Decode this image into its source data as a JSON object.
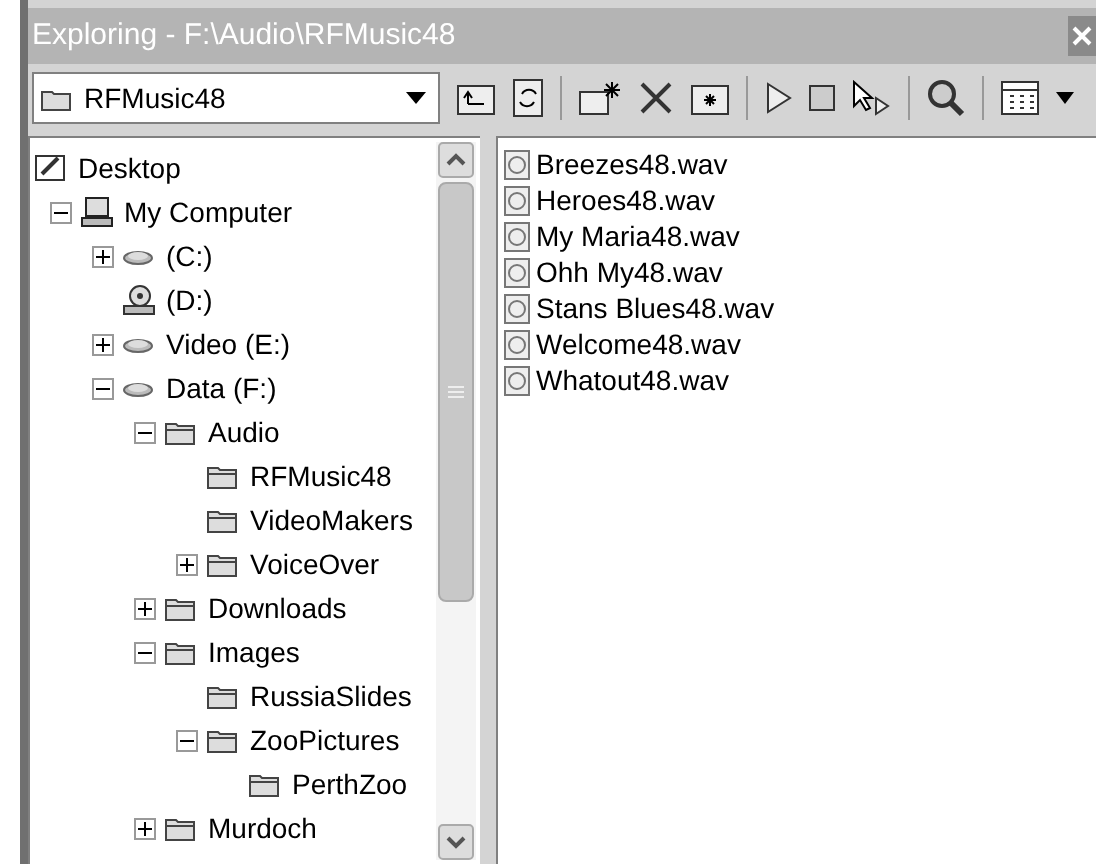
{
  "window": {
    "title": "Exploring - F:\\Audio\\RFMusic48"
  },
  "address": {
    "value": "RFMusic48"
  },
  "tree": [
    {
      "label": "Desktop",
      "kind": "desktop",
      "children": [
        {
          "label": "My Computer",
          "kind": "computer",
          "expanded": true,
          "children": [
            {
              "label": "(C:)",
              "kind": "drive",
              "expanded": false
            },
            {
              "label": "(D:)",
              "kind": "cdrom"
            },
            {
              "label": "Video (E:)",
              "kind": "drive",
              "expanded": false
            },
            {
              "label": "Data (F:)",
              "kind": "drive",
              "expanded": true,
              "children": [
                {
                  "label": "Audio",
                  "kind": "folder",
                  "expanded": true,
                  "children": [
                    {
                      "label": "RFMusic48",
                      "kind": "folder"
                    },
                    {
                      "label": "VideoMakers",
                      "kind": "folder"
                    },
                    {
                      "label": "VoiceOver",
                      "kind": "folder",
                      "expanded": false
                    }
                  ]
                },
                {
                  "label": "Downloads",
                  "kind": "folder",
                  "expanded": false
                },
                {
                  "label": "Images",
                  "kind": "folder",
                  "expanded": true,
                  "children": [
                    {
                      "label": "RussiaSlides",
                      "kind": "folder"
                    },
                    {
                      "label": "ZooPictures",
                      "kind": "folder",
                      "expanded": true,
                      "children": [
                        {
                          "label": "PerthZoo",
                          "kind": "folder"
                        }
                      ]
                    }
                  ]
                },
                {
                  "label": "Murdoch",
                  "kind": "folder",
                  "expanded": false
                }
              ]
            }
          ]
        }
      ]
    }
  ],
  "files": [
    "Breezes48.wav",
    "Heroes48.wav",
    "My Maria48.wav",
    "Ohh My48.wav",
    "Stans Blues48.wav",
    "Welcome48.wav",
    "Whatout48.wav"
  ]
}
